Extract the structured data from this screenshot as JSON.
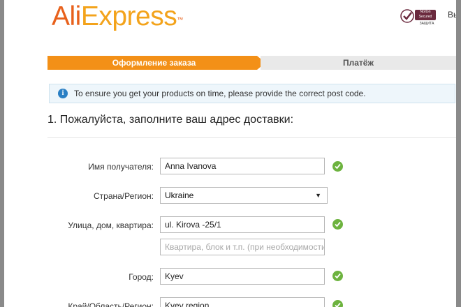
{
  "header": {
    "logo_primary": "Ali",
    "logo_secondary": "Express",
    "logo_mark": "™",
    "badge_top": "Norton Secured",
    "badge_bottom": "ЗАЩИТА",
    "right_cut_text": "Вы"
  },
  "steps": [
    {
      "label": "Оформление заказа",
      "active": true
    },
    {
      "label": "Платёж",
      "active": false
    }
  ],
  "notice": {
    "icon": "info-icon",
    "text": "To ensure you get your products on time, please provide the correct post code."
  },
  "form": {
    "title": "1. Пожалуйста, заполните ваш адрес доставки:",
    "recipient": {
      "label": "Имя получателя:",
      "value": "Anna Ivanova",
      "valid": true
    },
    "country": {
      "label": "Страна/Регион:",
      "value": "Ukraine"
    },
    "street": {
      "label": "Улица, дом, квартира:",
      "value": "ul. Kirova -25/1",
      "valid": true
    },
    "street2": {
      "placeholder": "Квартира, блок и т.п. (при необходимости)"
    },
    "city": {
      "label": "Город:",
      "value": "Kyev",
      "valid": true
    },
    "region": {
      "label": "Край/Область/Регион:",
      "value": "Kyev region",
      "valid": true
    }
  },
  "colors": {
    "brand_orange": "#e8611c",
    "step_active": "#f39017",
    "info_blue": "#2a7fc4",
    "valid_green": "#6db33f"
  }
}
